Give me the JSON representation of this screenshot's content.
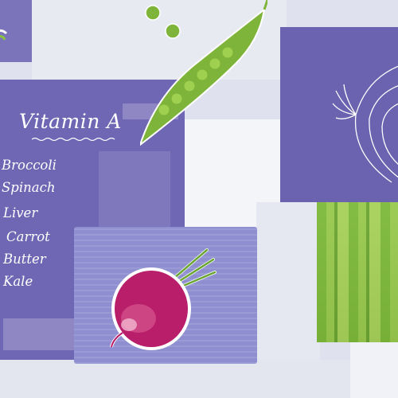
{
  "title": "Vitamin A",
  "foods": [
    "Broccoli",
    "Spinach",
    "Liver",
    "Carrot",
    "Butter",
    "Kale"
  ],
  "colors": {
    "purple_panel": "#6f66b4",
    "light_purple_panel": "#8e8ed0",
    "lime_green": "#7db93a",
    "beet_magenta": "#b81e6a",
    "pea_green": "#7fb43a",
    "background": "#dfe2ee"
  },
  "illustrations": [
    "pea-pod-icon",
    "peas-icon",
    "onion-sketch-icon",
    "beetroot-icon",
    "green-stripes"
  ]
}
